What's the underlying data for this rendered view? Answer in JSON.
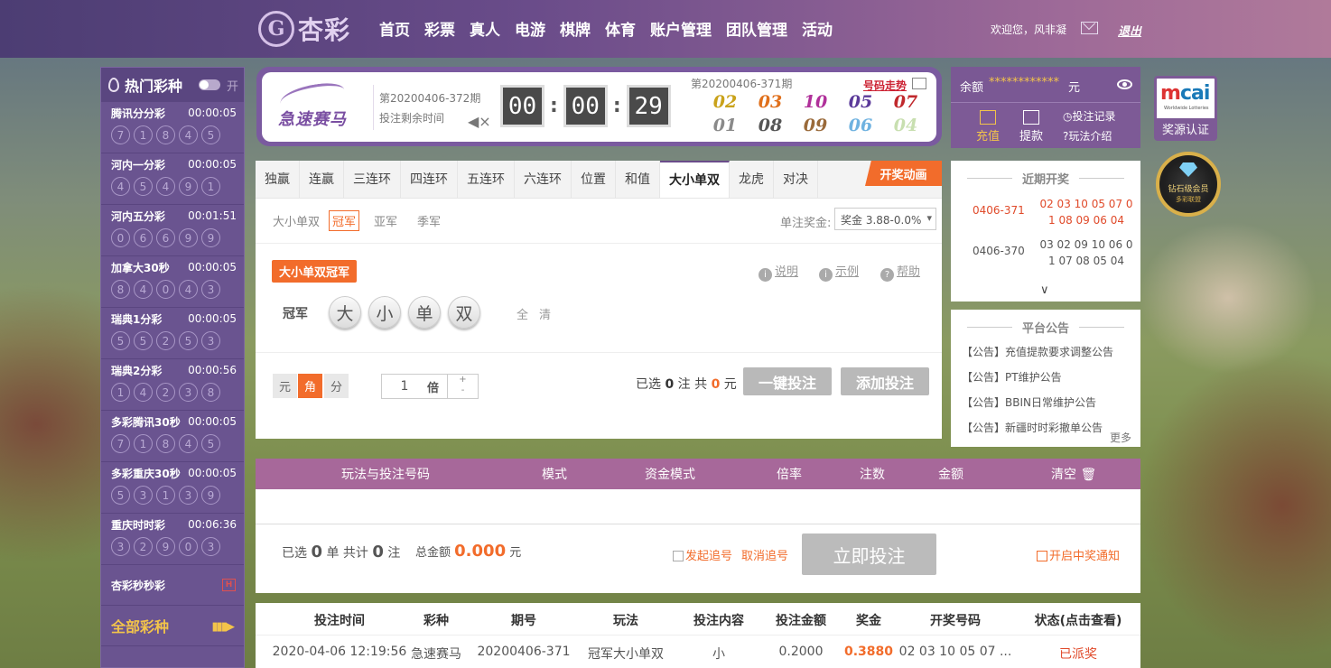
{
  "header": {
    "logo_mark": "G",
    "logo_text": "杏彩",
    "nav": [
      "首页",
      "彩票",
      "真人",
      "电游",
      "棋牌",
      "体育",
      "账户管理",
      "团队管理",
      "活动"
    ],
    "welcome": "欢迎您，风非凝",
    "logout": "退出"
  },
  "sidebar": {
    "title": "热门彩种",
    "toggle_label": "开",
    "games": [
      {
        "name": "腾讯分分彩",
        "time": "00:00:05",
        "balls": [
          "7",
          "1",
          "8",
          "4",
          "5"
        ]
      },
      {
        "name": "河内一分彩",
        "time": "00:00:05",
        "balls": [
          "4",
          "5",
          "4",
          "9",
          "1"
        ]
      },
      {
        "name": "河内五分彩",
        "time": "00:01:51",
        "balls": [
          "0",
          "6",
          "6",
          "9",
          "9"
        ]
      },
      {
        "name": "加拿大30秒",
        "time": "00:00:05",
        "balls": [
          "8",
          "4",
          "0",
          "4",
          "3"
        ]
      },
      {
        "name": "瑞典1分彩",
        "time": "00:00:05",
        "balls": [
          "5",
          "5",
          "2",
          "5",
          "3"
        ]
      },
      {
        "name": "瑞典2分彩",
        "time": "00:00:56",
        "balls": [
          "1",
          "4",
          "2",
          "3",
          "8"
        ]
      },
      {
        "name": "多彩腾讯30秒",
        "time": "00:00:05",
        "balls": [
          "7",
          "1",
          "8",
          "4",
          "5"
        ]
      },
      {
        "name": "多彩重庆30秒",
        "time": "00:00:05",
        "balls": [
          "5",
          "3",
          "1",
          "3",
          "9"
        ]
      },
      {
        "name": "重庆时时彩",
        "time": "00:06:36",
        "balls": [
          "3",
          "2",
          "9",
          "0",
          "3"
        ]
      }
    ],
    "extra_game": "杏彩秒秒彩",
    "extra_badge": "H",
    "all_games": "全部彩种",
    "all_arrows": "▮▮▮▶"
  },
  "lottery": {
    "name": "急速赛马",
    "current_issue": "第20200406-372期",
    "remain_label": "投注剩余时间",
    "speaker": "◀×",
    "timer": [
      "00",
      "00",
      "29"
    ],
    "prev_issue": "第20200406-371期",
    "trend": "号码走势",
    "prev_numbers": [
      {
        "n": "02",
        "color": "#c9a21a"
      },
      {
        "n": "03",
        "color": "#e0701c"
      },
      {
        "n": "10",
        "color": "#b0309a"
      },
      {
        "n": "05",
        "color": "#5b3a9a"
      },
      {
        "n": "07",
        "color": "#c0282c"
      },
      {
        "n": "01",
        "color": "#8a8a8a"
      },
      {
        "n": "08",
        "color": "#555555"
      },
      {
        "n": "09",
        "color": "#9a6a3a"
      },
      {
        "n": "06",
        "color": "#6fb2e0"
      },
      {
        "n": "04",
        "color": "#c8dfb0"
      }
    ]
  },
  "account": {
    "balance_label": "余额",
    "balance_value": "************",
    "balance_unit": "元",
    "recharge": "充值",
    "withdraw": "提款",
    "bet_record": "◷投注记录",
    "play_intro": "?玩法介绍"
  },
  "cert": {
    "logo_a": "m",
    "logo_b": "cai",
    "sub": "Worldwide Lotteries",
    "label": "奖源认证",
    "diamond_line1": "钻石级会员",
    "diamond_line2": "多彩联盟"
  },
  "bet": {
    "tabs": [
      "独赢",
      "连赢",
      "三连环",
      "四连环",
      "五连环",
      "六连环",
      "位置",
      "和值",
      "大小单双",
      "龙虎",
      "对决"
    ],
    "active_tab": "大小单双",
    "animation_btn": "开奖动画",
    "sub_tabs": [
      "大小单双",
      "冠军",
      "亚军",
      "季军"
    ],
    "active_sub": "冠军",
    "prize_label": "单注奖金:",
    "prize_value": "奖金 3.88-0.0%",
    "play_tag": "大小单双冠军",
    "help_items": [
      "说明",
      "示例",
      "帮助"
    ],
    "position_label": "冠军",
    "choices": [
      "大",
      "小",
      "单",
      "双"
    ],
    "full_clear": "全清",
    "units": [
      "元",
      "角",
      "分"
    ],
    "active_unit": "角",
    "multiplier": "1",
    "multiplier_unit": "倍",
    "selected_prefix": "已选",
    "selected_count": "0",
    "selected_mid": "注  共",
    "selected_amount": "0",
    "selected_suffix": "元",
    "quick_bet": "一键投注",
    "add_bet": "添加投注"
  },
  "recent": {
    "title": "近期开奖",
    "draws": [
      {
        "issue": "0406-371",
        "nums": "02 03 10 05 07 0 1 08 09 06 04",
        "color": "#e04a2a"
      },
      {
        "issue": "0406-370",
        "nums": "03 02 09 10 06 0 1 07 08 05 04",
        "color": "#555555"
      }
    ],
    "expand": "∨"
  },
  "announce": {
    "title": "平台公告",
    "items": [
      "【公告】充值提款要求调整公告",
      "【公告】PT维护公告",
      "【公告】BBIN日常维护公告",
      "【公告】新疆时时彩撤单公告"
    ],
    "more": "更多"
  },
  "cart": {
    "headers": [
      "玩法与投注号码",
      "模式",
      "资金模式",
      "倍率",
      "注数",
      "金额",
      "清空 🗑"
    ],
    "sel_prefix": "已选",
    "sel_count": "0",
    "sel_mid": "单 共计",
    "sel_bets": "0",
    "sel_suffix": "注",
    "total_label": "总金额",
    "total_value": "0.000",
    "total_unit": "元",
    "chase": "发起追号",
    "cancel_chase": "取消追号",
    "buy_now": "立即投注",
    "notify": "开启中奖通知"
  },
  "records": {
    "headers": [
      "投注时间",
      "彩种",
      "期号",
      "玩法",
      "投注内容",
      "投注金额",
      "奖金",
      "开奖号码",
      "状态(点击查看)"
    ],
    "rows": [
      {
        "time": "2020-04-06 12:19:56",
        "game": "急速赛马",
        "issue": "20200406-371",
        "play": "冠军大小单双",
        "content": "小",
        "amount": "0.2000",
        "prize": "0.3880",
        "draw": "02 03 10 05 07 ...",
        "status": "已派奖"
      }
    ]
  },
  "colors": {
    "accent": "#f26c2b",
    "purple": "#6a4c8a",
    "gold": "#f3c44a"
  }
}
